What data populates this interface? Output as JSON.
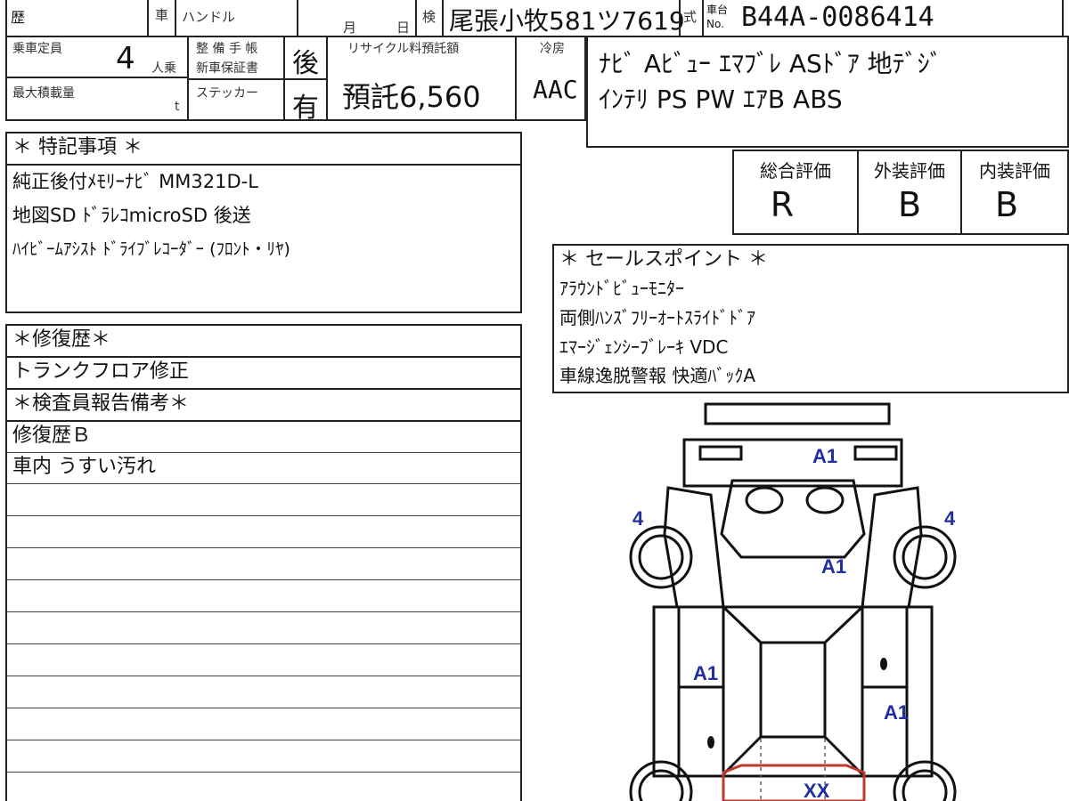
{
  "header": {
    "reki_label": "歴",
    "sha_label": "車",
    "handle_label": "ハンドル",
    "month_label": "月",
    "day_label": "日",
    "ken_label": "検",
    "plate": "尾張小牧581ツ7619",
    "shiki_label": "式",
    "chassis_label": "車台",
    "no_label": "No.",
    "chassis_no": "B44A-0086414"
  },
  "row2": {
    "capacity_label": "乗車定員",
    "capacity_value": "4",
    "capacity_unit": "人乗",
    "maintenance_label": "整 備 手 帳",
    "warranty_label": "新車保証書",
    "maintenance_value": "後",
    "recycle_label": "リサイクル料預託額",
    "recycle_value": "預託6,560",
    "aircon_label": "冷房",
    "aircon_value": "AAC",
    "maxload_label": "最大積載量",
    "maxload_unit": "t",
    "sticker_label": "ステッカー",
    "sticker_value": "有"
  },
  "equipment": {
    "line1": "ﾅﾋﾞ Aﾋﾞｭｰ ｴﾏﾌﾞﾚ ASﾄﾞｱ 地ﾃﾞｼﾞ",
    "line2": "ｲﾝﾃﾘ PS PW ｴｱB ABS"
  },
  "evaluation": {
    "overall_label": "総合評価",
    "overall_value": "R",
    "exterior_label": "外装評価",
    "exterior_value": "B",
    "interior_label": "内装評価",
    "interior_value": "B"
  },
  "special": {
    "title": "＊ 特記事項 ＊",
    "lines": [
      "純正後付ﾒﾓﾘｰﾅﾋﾞ MM321D-L",
      "地図SD ﾄﾞﾗﾚｺmicroSD 後送",
      "ﾊｲﾋﾞｰﾑｱｼｽﾄ ﾄﾞﾗｲﾌﾞﾚｺｰﾀﾞｰ (ﾌﾛﾝﾄ・ﾘﾔ)"
    ]
  },
  "repair": {
    "title": "＊修復歴＊",
    "value": "トランクフロア修正"
  },
  "inspector": {
    "title": "＊検査員報告備考＊",
    "lines": [
      "修復歴Ｂ",
      "車内 うすい汚れ"
    ]
  },
  "sales": {
    "title": "＊ セールスポイント ＊",
    "lines": [
      "ｱﾗｳﾝﾄﾞﾋﾞｭｰﾓﾆﾀｰ",
      "両側ﾊﾝｽﾞﾌﾘｰｵｰﾄｽﾗｲﾄﾞﾄﾞｱ",
      "ｴﾏｰｼﾞｪﾝｼｰﾌﾞﾚｰｷ VDC",
      "車線逸脱警報 快適ﾊﾞｯｸA"
    ]
  },
  "diagram": {
    "marks": [
      "A1",
      "4",
      "4",
      "A1",
      "A1",
      "A1",
      "XX"
    ],
    "mark_color": "#1f2f9e",
    "repair_color": "#c0392b"
  }
}
